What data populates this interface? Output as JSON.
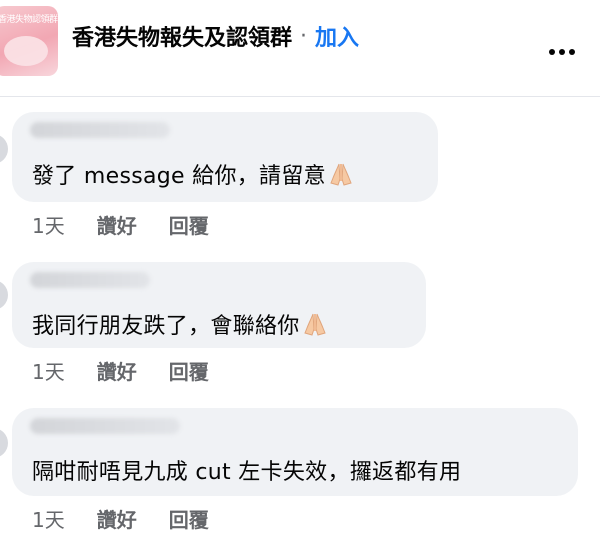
{
  "header": {
    "group_name": "香港失物報失及認領群",
    "separator": "·",
    "join_label": "加入",
    "thumbnail_text": "香港失物認領群"
  },
  "comments": [
    {
      "text": "發了 message 給你，請留意",
      "emoji": "pray-icon",
      "time": "1天",
      "like_label": "讚好",
      "reply_label": "回覆"
    },
    {
      "text": "我同行朋友跌了，會聯絡你",
      "emoji": "pray-icon",
      "time": "1天",
      "like_label": "讚好",
      "reply_label": "回覆"
    },
    {
      "text": "隔咁耐唔見九成 cut 左卡失效，攞返都有用",
      "emoji": "",
      "time": "1天",
      "like_label": "讚好",
      "reply_label": "回覆"
    }
  ],
  "colors": {
    "accent": "#1877f2",
    "bubble": "#f0f2f5",
    "secondary_text": "#65676b"
  }
}
